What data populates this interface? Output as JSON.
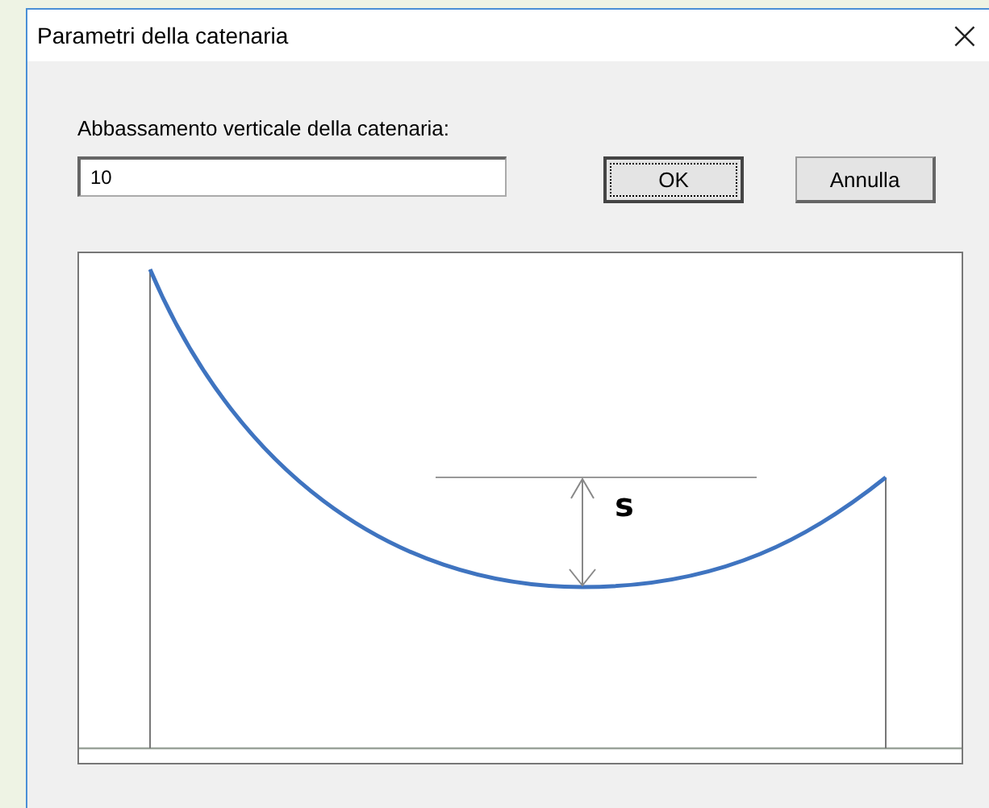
{
  "window": {
    "title": "Parametri della catenaria",
    "close": "×"
  },
  "field": {
    "label": "Abbassamento verticale della catenaria:",
    "value": "10"
  },
  "buttons": [
    {
      "label": "OK",
      "focused": true
    },
    {
      "label": "Annulla",
      "focused": false
    }
  ],
  "diagram": {
    "sag_label": "s"
  }
}
